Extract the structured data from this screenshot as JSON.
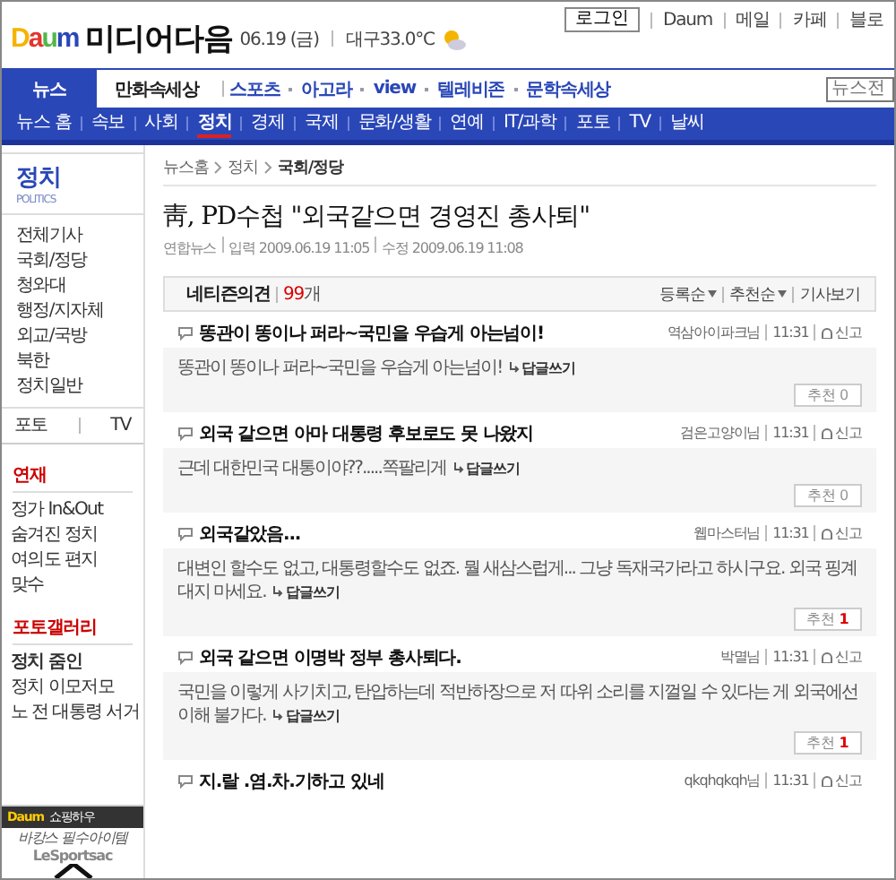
{
  "header": {
    "logo": "Daum",
    "service": "미디어다음",
    "date": "06.19 (금)",
    "weather": "대구33.0°C",
    "login": "로그인",
    "links": [
      "Daum",
      "메일",
      "카페",
      "블로"
    ]
  },
  "main_tabs": [
    {
      "label": "뉴스",
      "selected": true
    },
    {
      "label": "만화속세상",
      "selected": false
    }
  ],
  "service_links": [
    "스포츠",
    "아고라",
    "view",
    "텔레비존",
    "문학속세상"
  ],
  "search": {
    "placeholder": "뉴스전"
  },
  "subnav": [
    {
      "label": "뉴스 홈",
      "selected": false
    },
    {
      "label": "속보",
      "selected": false
    },
    {
      "label": "사회",
      "selected": false
    },
    {
      "label": "정치",
      "selected": true
    },
    {
      "label": "경제",
      "selected": false
    },
    {
      "label": "국제",
      "selected": false
    },
    {
      "label": "문화/생활",
      "selected": false
    },
    {
      "label": "연예",
      "selected": false
    },
    {
      "label": "IT/과학",
      "selected": false
    },
    {
      "label": "포토",
      "selected": false
    },
    {
      "label": "TV",
      "selected": false
    },
    {
      "label": "날씨",
      "selected": false
    }
  ],
  "sidebar": {
    "title": "정치",
    "subtitle": "POLITICS",
    "items": [
      "전체기사",
      "국회/정당",
      "청와대",
      "행정/지자체",
      "외교/국방",
      "북한",
      "정치일반"
    ],
    "media": [
      "포토",
      "TV"
    ],
    "sections": [
      {
        "heading": "연재",
        "items": [
          {
            "label": "정가 In&Out",
            "selected": false
          },
          {
            "label": "숨겨진 정치",
            "selected": false
          },
          {
            "label": "여의도 편지",
            "selected": false
          },
          {
            "label": "맞수",
            "selected": false
          }
        ]
      },
      {
        "heading": "포토갤러리",
        "items": [
          {
            "label": "정치 줌인",
            "selected": true
          },
          {
            "label": "정치 이모저모",
            "selected": false
          },
          {
            "label": "노 전 대통령 서거",
            "selected": false
          }
        ]
      }
    ],
    "ad": {
      "logo": "Daum",
      "label": "쇼핑하우",
      "slogan": "바캉스 필수아이템",
      "brand": "LeSportsac"
    }
  },
  "article": {
    "breadcrumb": [
      "뉴스홈",
      "정치",
      "국회/정당"
    ],
    "title": "靑, PD수첩 \"외국같으면 경영진 총사퇴\"",
    "source": "연합뉴스",
    "published": "입력 2009.06.19 11:05",
    "modified": "수정 2009.06.19 11:08"
  },
  "comments_bar": {
    "label": "네티즌의견",
    "count": "99",
    "unit": "개",
    "sorts": [
      "등록순",
      "추천순"
    ],
    "view_article": "기사보기"
  },
  "comments": [
    {
      "title": "똥관이 똥이나 퍼라~국민을 우습게 아는넘이!",
      "author": "역삼아이파크님",
      "time": "11:31",
      "report": "신고",
      "body": "똥관이 똥이나 퍼라~국민을 우습게 아는넘이!",
      "reply": "답글쓰기",
      "recommend": "추천",
      "votes": "0",
      "voted": false
    },
    {
      "title": "외국 같으면 아마 대통령 후보로도 못 나왔지",
      "author": "검은고양이님",
      "time": "11:31",
      "report": "신고",
      "body": "근데 대한민국 대통이야??.....쪽팔리게",
      "reply": "답글쓰기",
      "recommend": "추천",
      "votes": "0",
      "voted": false
    },
    {
      "title": "외국같았음...",
      "author": "웹마스터님",
      "time": "11:31",
      "report": "신고",
      "body": "대변인 할수도 없고, 대통령할수도 없죠. 뭘 새삼스럽게... 그냥 독재국가라고 하시구요. 외국 핑계대지 마세요.",
      "reply": "답글쓰기",
      "recommend": "추천",
      "votes": "1",
      "voted": true
    },
    {
      "title": "외국 같으면 이명박 정부 총사퇴다.",
      "author": "박멸님",
      "time": "11:31",
      "report": "신고",
      "body": "국민을 이렇게 사기치고, 탄압하는데 적반하장으로 저 따위 소리를 지껄일 수 있다는 게 외국에선 이해 불가다.",
      "reply": "답글쓰기",
      "recommend": "추천",
      "votes": "1",
      "voted": true
    },
    {
      "title": "지.랄 .염.차.기하고 있네",
      "author": "qkqhqkqh님",
      "time": "11:31",
      "report": "신고"
    }
  ]
}
